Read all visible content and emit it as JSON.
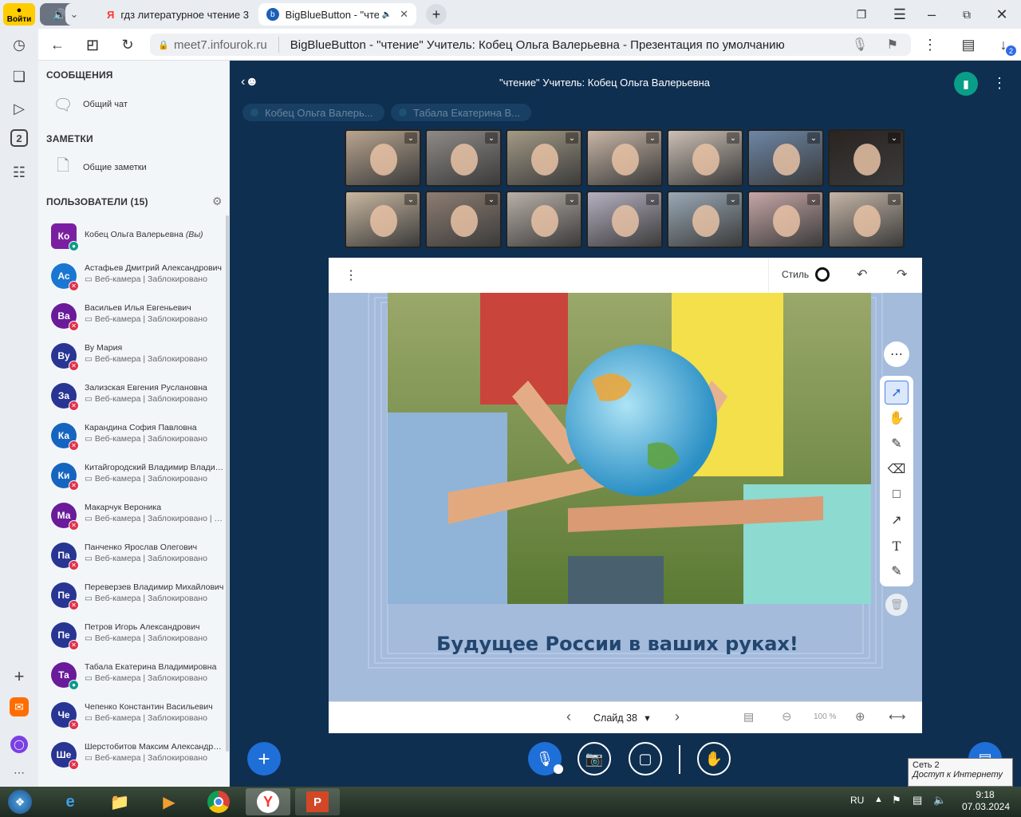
{
  "browser": {
    "login_label": "Войти",
    "tabs": [
      {
        "label": "гдз литературное чтение 3",
        "favicon": "Я"
      },
      {
        "label": "BigBlueButton - \"чте",
        "favicon": "b"
      }
    ],
    "url_host": "meet7.infourok.ru",
    "page_title": "BigBlueButton - \"чтение\" Учитель: Кобец Ольга Валерьевна - Презентация по умолчанию",
    "downloads_badge": "2",
    "rail_badge": "2"
  },
  "panel": {
    "messages_title": "СООБЩЕНИЯ",
    "public_chat": "Общий чат",
    "notes_title": "ЗАМЕТКИ",
    "shared_notes": "Общие заметки",
    "users_title": "ПОЛЬЗОВАТЕЛИ (15)",
    "users": [
      {
        "initials": "Ко",
        "name": "Кобец Ольга Валерьевна",
        "you": "(Вы)",
        "status": "",
        "color": "#7b1fa2",
        "badge": "mic"
      },
      {
        "initials": "Ас",
        "name": "Астафьев Дмитрий Александрович",
        "status": "Веб-камера | Заблокировано",
        "color": "#1976d2",
        "badge": "mute"
      },
      {
        "initials": "Ва",
        "name": "Васильев Илья Евгеньевич",
        "status": "Веб-камера | Заблокировано",
        "color": "#6a1b9a",
        "badge": "mute"
      },
      {
        "initials": "Ву",
        "name": "Ву Мария",
        "status": "Веб-камера | Заблокировано",
        "color": "#283593",
        "badge": "mute"
      },
      {
        "initials": "За",
        "name": "Зализская Евгения Руслановна",
        "status": "Веб-камера | Заблокировано",
        "color": "#283593",
        "badge": "mute"
      },
      {
        "initials": "Ка",
        "name": "Карандина София Павловна",
        "status": "Веб-камера | Заблокировано",
        "color": "#1565c0",
        "badge": "mute"
      },
      {
        "initials": "Ки",
        "name": "Китайгородский Владимир Владимирович",
        "status": "Веб-камера | Заблокировано",
        "color": "#1565c0",
        "badge": "mute"
      },
      {
        "initials": "Ма",
        "name": "Макарчук Вероника",
        "status": "Веб-камера | Заблокировано | Заблокировано",
        "color": "#6a1b9a",
        "badge": "mute"
      },
      {
        "initials": "Па",
        "name": "Панченко Ярослав Олегович",
        "status": "Веб-камера | Заблокировано",
        "color": "#283593",
        "badge": "mute"
      },
      {
        "initials": "Пе",
        "name": "Переверзев Владимир Михайлович",
        "status": "Веб-камера | Заблокировано",
        "color": "#283593",
        "badge": "mute"
      },
      {
        "initials": "Пе",
        "name": "Петров Игорь Александрович",
        "status": "Веб-камера | Заблокировано",
        "color": "#283593",
        "badge": "mute"
      },
      {
        "initials": "Та",
        "name": "Табала Екатерина Владимировна",
        "status": "Веб-камера | Заблокировано",
        "color": "#6a1b9a",
        "badge": "mic"
      },
      {
        "initials": "Че",
        "name": "Чепенко Константин Васильевич",
        "status": "Веб-камера | Заблокировано",
        "color": "#283593",
        "badge": "mute"
      },
      {
        "initials": "Ше",
        "name": "Шерстобитов Максим Александрович",
        "status": "Веб-камера | Заблокировано",
        "color": "#283593",
        "badge": "mute"
      }
    ]
  },
  "meeting": {
    "title": "\"чтение\" Учитель: Кобец Ольга Валерьевна",
    "talkers": [
      "Кобец Ольга Валерь...",
      "Табала Екатерина В..."
    ],
    "cam_colors": [
      "#b9a58f",
      "#8e8a86",
      "#a39a86",
      "#c8b5a6",
      "#cbbfb4",
      "#6d86a6",
      "#2a2420",
      "#c9b7a0",
      "#8d7d72",
      "#b8b0a8",
      "#b5b0c0",
      "#9aa9b5",
      "#c7a6a6",
      "#c4b5a6"
    ]
  },
  "presentation": {
    "style_label": "Стиль",
    "slide_caption": "Будущее России  в ваших руках!",
    "slide_label": "Слайд 38",
    "zoom": "100 %"
  },
  "tray": {
    "lang": "RU",
    "time": "9:18",
    "date": "07.03.2024",
    "net_name": "Сеть  2",
    "net_status": "Доступ к Интернету"
  }
}
